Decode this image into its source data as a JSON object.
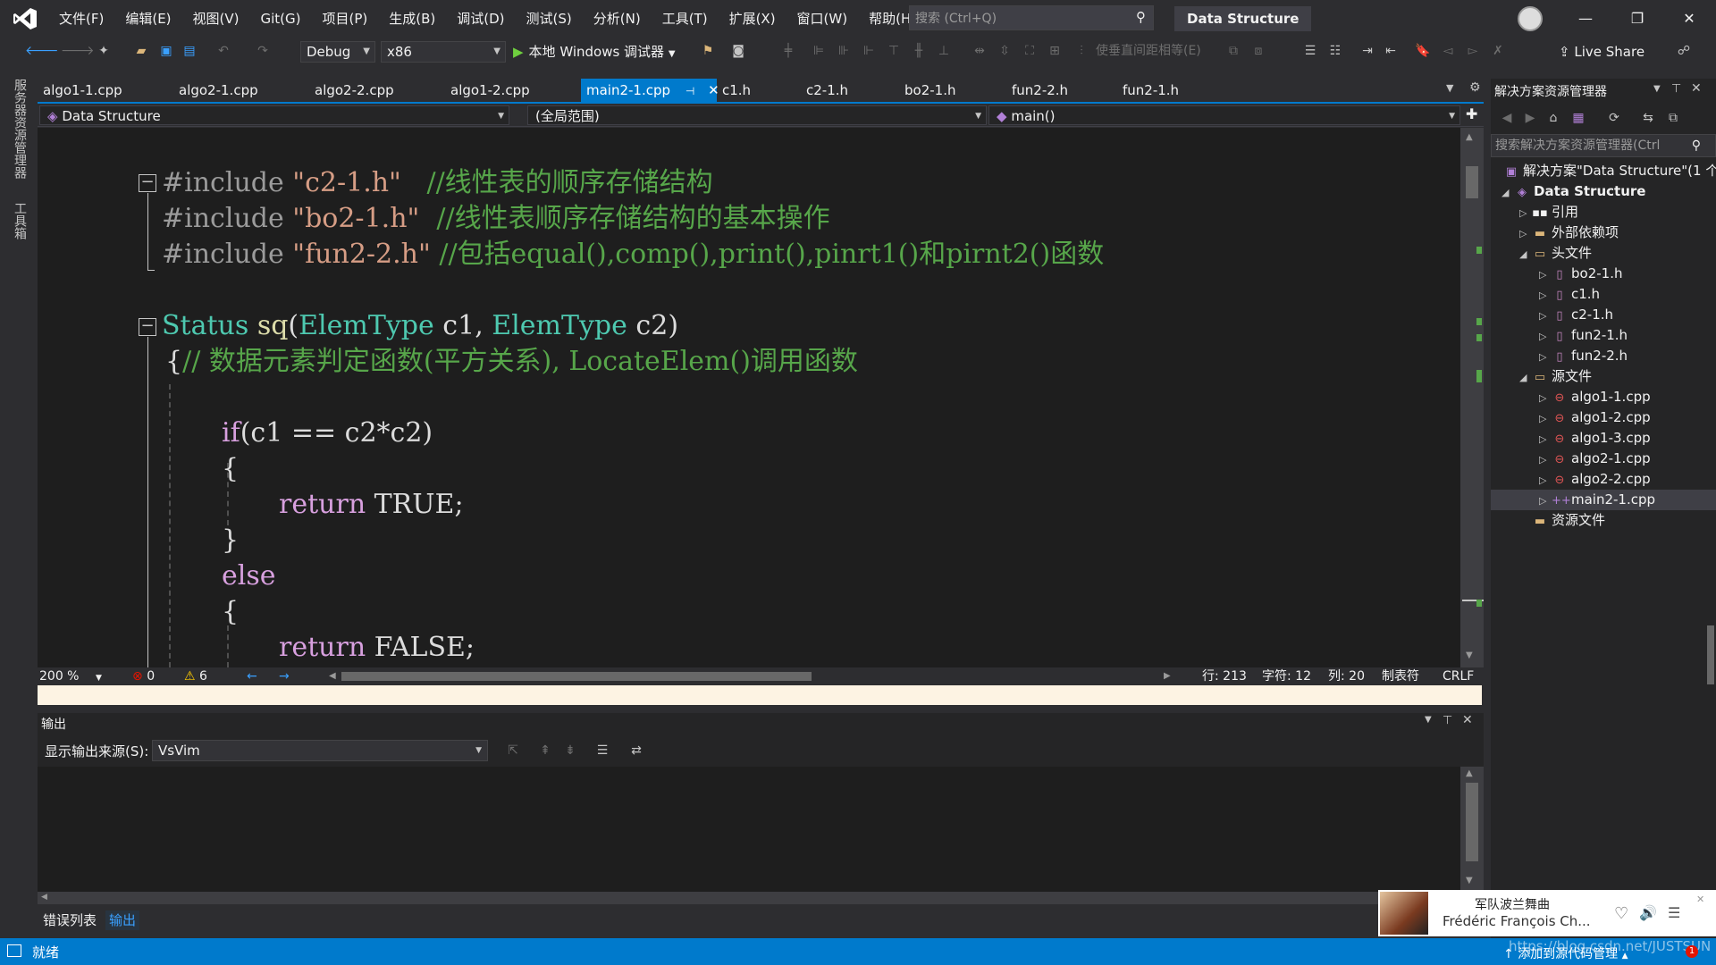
{
  "menu": [
    "文件(F)",
    "编辑(E)",
    "视图(V)",
    "Git(G)",
    "项目(P)",
    "生成(B)",
    "调试(D)",
    "测试(S)",
    "分析(N)",
    "工具(T)",
    "扩展(X)",
    "窗口(W)",
    "帮助(H)"
  ],
  "search": {
    "placeholder": "搜索 (Ctrl+Q)"
  },
  "solution_title": "Data Structure",
  "toolbar": {
    "config": "Debug",
    "platform": "x86",
    "run_label": "本地 Windows 调试器",
    "spacing_label": "使垂直间距相等(E)",
    "live_share": "Live Share"
  },
  "left_tabs": [
    "服务器资源管理器",
    "工具箱"
  ],
  "doc_tabs": [
    "algo1-1.cpp",
    "algo2-1.cpp",
    "algo2-2.cpp",
    "algo1-2.cpp",
    "main2-1.cpp",
    "c1.h",
    "c2-1.h",
    "bo2-1.h",
    "fun2-2.h",
    "fun2-1.h"
  ],
  "active_tab": "main2-1.cpp",
  "nav": {
    "project": "Data Structure",
    "scope": "(全局范围)",
    "member": "main()"
  },
  "code": {
    "inc1_dir": "#include",
    "inc1_file": "\"c2-1.h\"",
    "inc1_cmt": "//线性表的顺序存储结构",
    "inc2_dir": "#include",
    "inc2_file": "\"bo2-1.h\"",
    "inc2_cmt": "//线性表顺序存储结构的基本操作",
    "inc3_dir": "#include",
    "inc3_file": "\"fun2-2.h\"",
    "inc3_cmt": "//包括equal(),comp(),print(),pinrt1()和pirnt2()函数",
    "sig_type": "Status",
    "sig_fn": "sq",
    "sig_p1type": "ElemType",
    "sig_p1": " c1, ",
    "sig_p2type": "ElemType",
    "sig_p2": " c2)",
    "brace_open": "{",
    "brace_cmt": "// 数据元素判定函数(平方关系), LocateElem()调用函数",
    "if_kw": "if",
    "if_cond": "(c1 == c2*c2)",
    "lbrace": "{",
    "ret1_kw": "return",
    "ret1_val": " TRUE;",
    "rbrace": "}",
    "else_kw": "else",
    "lbrace2": "{",
    "ret2_kw": "return",
    "ret2_val": " FALSE;"
  },
  "editor_status": {
    "zoom": "200 %",
    "errors": "0",
    "warnings": "6",
    "line": "行: 213",
    "char": "字符: 12",
    "col": "列: 20",
    "tab": "制表符",
    "eol": "CRLF"
  },
  "output": {
    "title": "输出",
    "source_label": "显示输出来源(S):",
    "source_value": "VsVim"
  },
  "bottom_tabs": [
    "错误列表",
    "输出"
  ],
  "solution_explorer": {
    "title": "解决方案资源管理器",
    "search_placeholder": "搜索解决方案资源管理器(Ctrl",
    "items": [
      {
        "label": "解决方案\"Data Structure\"(1 个",
        "level": 0
      },
      {
        "label": "Data Structure",
        "level": 1,
        "bold": true
      },
      {
        "label": "引用",
        "level": 2
      },
      {
        "label": "外部依赖项",
        "level": 2
      },
      {
        "label": "头文件",
        "level": 2
      },
      {
        "label": "bo2-1.h",
        "level": 3
      },
      {
        "label": "c1.h",
        "level": 3
      },
      {
        "label": "c2-1.h",
        "level": 3
      },
      {
        "label": "fun2-1.h",
        "level": 3
      },
      {
        "label": "fun2-2.h",
        "level": 3
      },
      {
        "label": "源文件",
        "level": 2
      },
      {
        "label": "algo1-1.cpp",
        "level": 3
      },
      {
        "label": "algo1-2.cpp",
        "level": 3
      },
      {
        "label": "algo1-3.cpp",
        "level": 3
      },
      {
        "label": "algo2-1.cpp",
        "level": 3
      },
      {
        "label": "algo2-2.cpp",
        "level": 3
      },
      {
        "label": "main2-1.cpp",
        "level": 3
      },
      {
        "label": "资源文件",
        "level": 2
      }
    ]
  },
  "music": {
    "title": "军队波兰舞曲",
    "artist": "Frédéric François Ch..."
  },
  "statusbar": {
    "ready": "就绪",
    "source_control": "添加到源代码管理",
    "watermark": "https://blog.csdn.net/JUSTSUN"
  },
  "colors": {
    "accent": "#007acc",
    "comment": "#57a64a",
    "string": "#d69d85",
    "type": "#4ec9b0",
    "keyword": "#d8a0df"
  }
}
